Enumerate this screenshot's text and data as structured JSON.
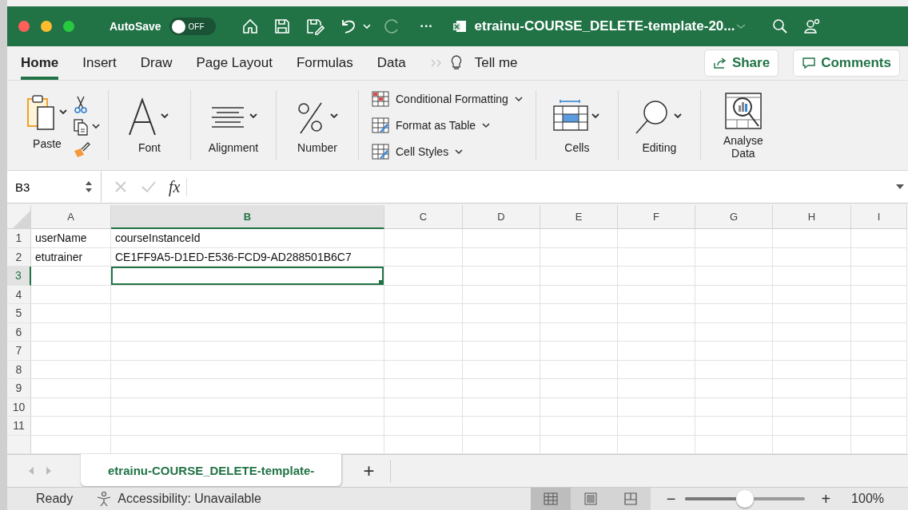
{
  "title_bar": {
    "autosave": {
      "label": "AutoSave",
      "toggle_text": "OFF",
      "on": false
    },
    "more": "···",
    "title": "etrainu-COURSE_DELETE-template-20..."
  },
  "ribbon": {
    "tabs": [
      {
        "label": "Home",
        "selected": true
      },
      {
        "label": "Insert",
        "selected": false
      },
      {
        "label": "Draw",
        "selected": false
      },
      {
        "label": "Page Layout",
        "selected": false
      },
      {
        "label": "Formulas",
        "selected": false
      },
      {
        "label": "Data",
        "selected": false
      }
    ],
    "tell_me": "Tell me",
    "share": "Share",
    "comments": "Comments",
    "groups": [
      {
        "kind": "paste",
        "label": "Paste"
      },
      {
        "kind": "font",
        "label": "Font"
      },
      {
        "kind": "alignment",
        "label": "Alignment"
      },
      {
        "kind": "number",
        "label": "Number"
      },
      {
        "kind": "styles",
        "items": [
          "Conditional Formatting",
          "Format as Table",
          "Cell Styles"
        ]
      },
      {
        "kind": "cells",
        "label": "Cells"
      },
      {
        "kind": "editing",
        "label": "Editing"
      },
      {
        "kind": "analyse",
        "label": "Analyse Data"
      }
    ]
  },
  "formula_bar": {
    "name_box": "B3",
    "function_label": "fx"
  },
  "sheet": {
    "columns": [
      {
        "label": "A",
        "selected": false
      },
      {
        "label": "B",
        "selected": true
      },
      {
        "label": "C",
        "selected": false
      },
      {
        "label": "D",
        "selected": false
      },
      {
        "label": "E",
        "selected": false
      },
      {
        "label": "F",
        "selected": false
      },
      {
        "label": "G",
        "selected": false
      },
      {
        "label": "H",
        "selected": false
      },
      {
        "label": "I",
        "selected": false
      }
    ],
    "rows": [
      {
        "label": "1",
        "selected": false,
        "cells": [
          {
            "text": "userName",
            "selected": false
          },
          {
            "text": "courseInstanceId",
            "selected": false
          }
        ]
      },
      {
        "label": "2",
        "selected": false,
        "cells": [
          {
            "text": "etutrainer",
            "selected": false
          },
          {
            "text": "CE1FF9A5-D1ED-E536-FCD9-AD288501B6C7",
            "selected": false
          }
        ]
      },
      {
        "label": "3",
        "selected": true,
        "cells": [
          {
            "selected": false
          },
          {
            "selected": true
          }
        ]
      },
      {
        "label": "4",
        "selected": false
      },
      {
        "label": "5",
        "selected": false
      },
      {
        "label": "6",
        "selected": false
      },
      {
        "label": "7",
        "selected": false
      },
      {
        "label": "8",
        "selected": false
      },
      {
        "label": "9",
        "selected": false
      },
      {
        "label": "10",
        "selected": false
      },
      {
        "label": "11",
        "selected": false
      }
    ]
  },
  "sheet_tabs": {
    "tabs": [
      {
        "label": "etrainu-COURSE_DELETE-template-",
        "selected": true
      }
    ],
    "add": "+"
  },
  "status_bar": {
    "state": "Ready",
    "accessibility": "Accessibility: Unavailable",
    "views": [
      {
        "kind": "normal",
        "selected": true
      },
      {
        "kind": "page_layout",
        "selected": false
      },
      {
        "kind": "page_break",
        "selected": false
      }
    ],
    "zoom_out": "−",
    "zoom_in": "+",
    "zoom": {
      "level": 0.5
    },
    "zoom_label": "100%"
  }
}
